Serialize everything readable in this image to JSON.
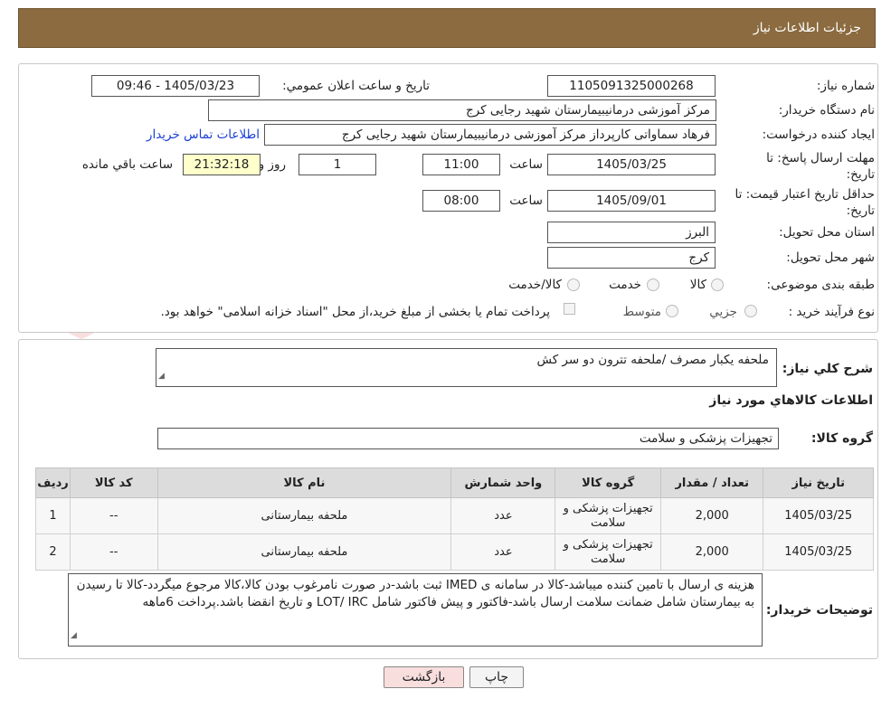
{
  "header": {
    "title": "جزئیات اطلاعات نیاز"
  },
  "form": {
    "need_number_label": "شماره نیاز:",
    "need_number": "1105091325000268",
    "announce_label": "تاریخ و ساعت اعلان عمومي:",
    "announce_value": "1405/03/23 - 09:46",
    "buyer_org_label": "نام دستگاه خريدار:",
    "buyer_org": "مرکز آموزشی درمانیبیمارستان شهید رجایی کرج",
    "creator_label": "ايجاد کننده درخواست:",
    "creator": "فرهاد سماواتی کارپرداز مرکز آموزشی درمانیبیمارستان شهید رجایی کرج",
    "contact_link": "اطلاعات تماس خريدار",
    "deadline_label_1": "مهلت ارسال پاسخ: تا",
    "deadline_label_2": "تاريخ:",
    "deadline_date": "1405/03/25",
    "time_label": "ساعت",
    "deadline_time": "11:00",
    "days_value": "1",
    "days_label": "روز و",
    "remaining_time": "21:32:18",
    "remaining_label": "ساعت باقي مانده",
    "validity_label_1": "حداقل تاريخ اعتبار قيمت: تا",
    "validity_label_2": "تاريخ:",
    "validity_date": "1405/09/01",
    "validity_time": "08:00",
    "province_label": "استان محل تحويل:",
    "province": "البرز",
    "city_label": "شهر محل تحويل:",
    "city": "کرج",
    "category_label": "طبقه بندی موضوعی:",
    "cat_goods": "کالا",
    "cat_service": "خدمت",
    "cat_both": "کالا/خدمت",
    "process_label": "نوع فرآيند خريد :",
    "proc_partial": "جزيي",
    "proc_medium": "متوسط",
    "payment_note": "پرداخت تمام يا بخشی از مبلغ خريد،از محل \"اسناد خزانه اسلامی\" خواهد بود."
  },
  "summary": {
    "desc_label": "شرح کلي نياز:",
    "desc_value": "ملحفه یکبار مصرف /ملحفه تترون دو سر کش",
    "goods_info_title": "اطلاعات کالاهاي مورد نياز",
    "group_label": "گروه کالا:",
    "group_value": "تجهیزات پزشکی و سلامت"
  },
  "table": {
    "headers": [
      "رديف",
      "کد کالا",
      "نام کالا",
      "واحد شمارش",
      "گروه کالا",
      "تعداد / مقدار",
      "تاريخ نياز"
    ],
    "rows": [
      [
        "1",
        "--",
        "ملحفه بیمارستانی",
        "عدد",
        "تجهیزات پزشکی و سلامت",
        "2,000",
        "1405/03/25"
      ],
      [
        "2",
        "--",
        "ملحفه بیمارستانی",
        "عدد",
        "تجهیزات پزشکی و سلامت",
        "2,000",
        "1405/03/25"
      ]
    ]
  },
  "notes": {
    "label": "توضيحات خريدار:",
    "text": "هزینه ی ارسال با تامین کننده میباشد-کالا در سامانه ی IMED ثبت باشد-در صورت نامرغوب بودن کالا،کالا مرجوع میگردد-کالا تا رسیدن به بیمارستان شامل ضمانت سلامت ارسال باشد-فاکتور و پیش فاکتور شامل LOT/ IRC و تاریخ انقضا باشد.پرداخت 6ماهه"
  },
  "buttons": {
    "print": "چاپ",
    "back": "بازگشت"
  },
  "watermark": {
    "text": "AriaTender.neT"
  },
  "colors": {
    "header_bg": "#8b6b3f",
    "link": "#1a3fd6",
    "back_button_bg": "#f9dede",
    "remaining_bg": "#ffffcc"
  }
}
